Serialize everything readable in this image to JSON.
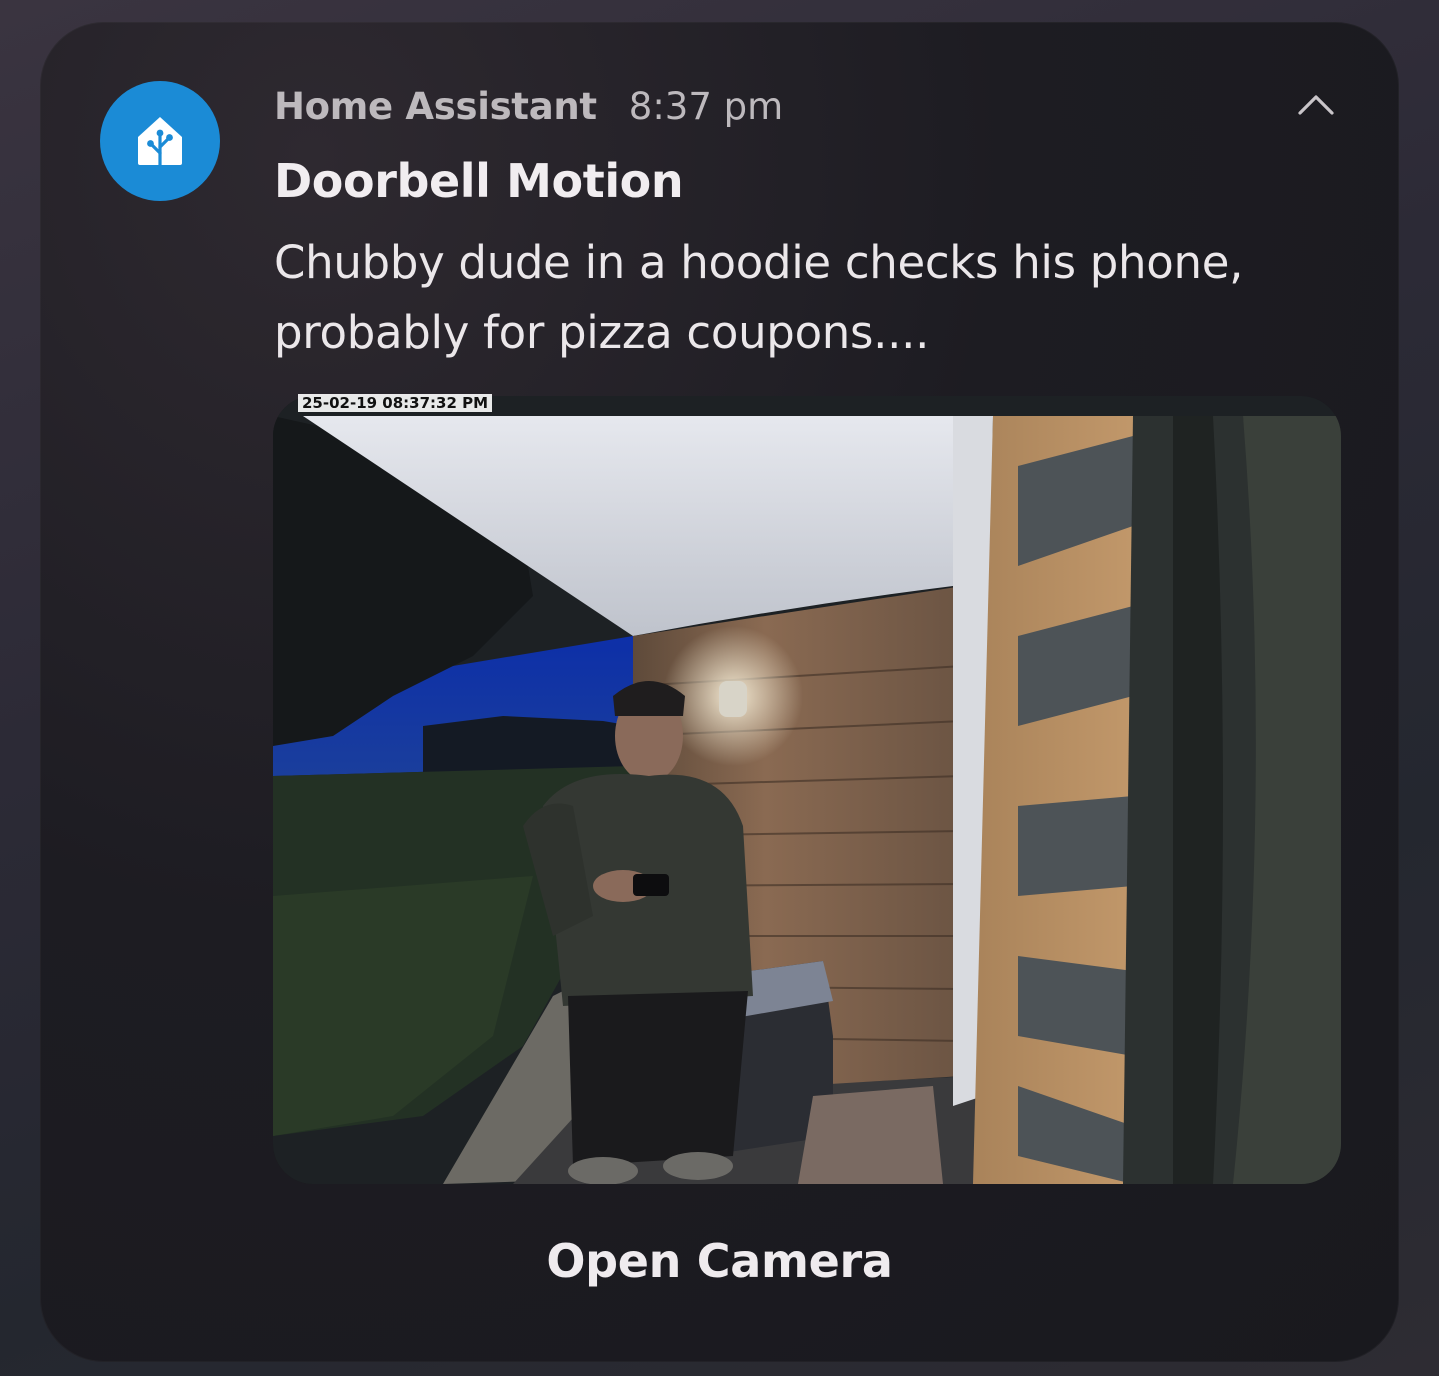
{
  "notification": {
    "app_name": "Home Assistant",
    "time": "8:37 pm",
    "title": "Doorbell Motion",
    "message": "Chubby dude in a hoodie checks his phone, probably for pizza coupons....",
    "snapshot_timestamp": "25-02-19 08:37:32 PM",
    "action_label": "Open Camera",
    "icons": {
      "app": "home-assistant-icon",
      "collapse": "chevron-up-icon"
    },
    "colors": {
      "app_icon_bg": "#1b8bd6",
      "card_bg": "#1d1c22"
    }
  }
}
